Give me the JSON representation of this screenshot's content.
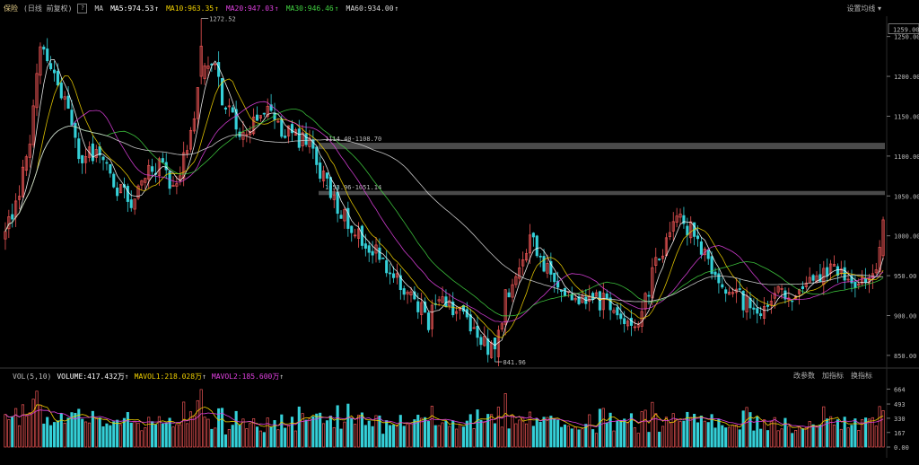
{
  "header": {
    "symbol": "保险",
    "period": "(日线 前复权)",
    "help": "?",
    "ma_label": "MA",
    "ma_items": [
      {
        "text": "MA5:974.53",
        "color": "#ffffff"
      },
      {
        "text": "MA10:963.35",
        "color": "#f0d000"
      },
      {
        "text": "MA20:947.03",
        "color": "#e040e0"
      },
      {
        "text": "MA30:946.46",
        "color": "#40d040"
      },
      {
        "text": "MA60:934.00",
        "color": "#d8d8d8"
      }
    ],
    "arrow": "↑",
    "settings": "设置均线"
  },
  "volume_header": {
    "label": "VOL(5,10)",
    "items": [
      {
        "text": "VOLUME:417.432万",
        "color": "#ffffff"
      },
      {
        "text": "MAVOL1:218.028万",
        "color": "#f0d000"
      },
      {
        "text": "MAVOL2:185.600万",
        "color": "#e040e0"
      }
    ],
    "arrow": "↑",
    "buttons": [
      "改参数",
      "加指标",
      "换指标"
    ]
  },
  "colors": {
    "up": "#ee5555",
    "down": "#35d0d8",
    "ma5": "#ffffff",
    "ma10": "#f0d000",
    "ma20": "#e040e0",
    "ma30": "#40d040",
    "ma60": "#d8d8d8"
  },
  "chart_data": [
    {
      "type": "candlestick",
      "ylim": [
        842,
        1262
      ],
      "yticks": [
        850,
        900,
        950,
        1000,
        1050,
        1100,
        1150,
        1200,
        1250
      ],
      "current_price_label": "1259.00",
      "annotations": [
        {
          "label": "1272.52",
          "value": 1272.52,
          "kind": "high"
        },
        {
          "label": "841.96",
          "value": 841.96,
          "kind": "low"
        }
      ],
      "zones": [
        {
          "label": "1114.40-1108.70",
          "low": 1108.7,
          "high": 1114.4
        },
        {
          "label": "1053.96-1051.14",
          "low": 1051.14,
          "high": 1053.96
        }
      ],
      "anchors": [
        [
          0,
          1000
        ],
        [
          6,
          1090
        ],
        [
          10,
          1230
        ],
        [
          14,
          1200
        ],
        [
          18,
          1150
        ],
        [
          22,
          1090
        ],
        [
          26,
          1110
        ],
        [
          32,
          1060
        ],
        [
          36,
          1040
        ],
        [
          40,
          1080
        ],
        [
          44,
          1090
        ],
        [
          48,
          1060
        ],
        [
          52,
          1110
        ],
        [
          56,
          1200
        ],
        [
          60,
          1210
        ],
        [
          63,
          1160
        ],
        [
          68,
          1130
        ],
        [
          74,
          1160
        ],
        [
          80,
          1130
        ],
        [
          86,
          1120
        ],
        [
          92,
          1060
        ],
        [
          98,
          1020
        ],
        [
          104,
          990
        ],
        [
          110,
          950
        ],
        [
          116,
          920
        ],
        [
          121,
          895
        ],
        [
          126,
          920
        ],
        [
          131,
          900
        ],
        [
          136,
          870
        ],
        [
          140,
          850
        ],
        [
          143,
          920
        ],
        [
          147,
          950
        ],
        [
          150,
          1000
        ],
        [
          155,
          960
        ],
        [
          160,
          930
        ],
        [
          166,
          915
        ],
        [
          171,
          920
        ],
        [
          176,
          890
        ],
        [
          181,
          900
        ],
        [
          186,
          960
        ],
        [
          192,
          1030
        ],
        [
          197,
          1000
        ],
        [
          202,
          960
        ],
        [
          206,
          930
        ],
        [
          212,
          915
        ],
        [
          218,
          910
        ],
        [
          222,
          930
        ],
        [
          226,
          920
        ],
        [
          231,
          940
        ],
        [
          237,
          960
        ],
        [
          242,
          940
        ],
        [
          246,
          935
        ],
        [
          251,
          990
        ]
      ]
    },
    {
      "type": "bar",
      "title": "VOL",
      "ylim": [
        0,
        720
      ],
      "unit": "万",
      "yticks": [
        0,
        167,
        330,
        493,
        664
      ],
      "tick_labels": [
        "0.00",
        "167",
        "330",
        "493",
        "664"
      ],
      "last_volume": 417.432,
      "mavol1": 218.028,
      "mavol2": 185.6
    }
  ]
}
